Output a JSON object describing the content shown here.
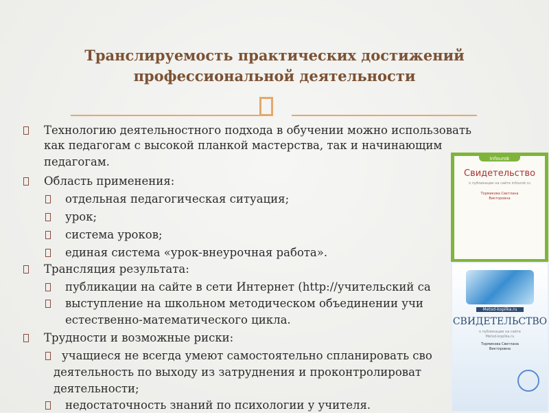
{
  "title": [
    "Транслируемость практических достижений",
    "профессиональной деятельности"
  ],
  "items": [
    {
      "level": 1,
      "lines": [
        "Технологию деятельностного подхода в обучении можно использовать",
        "как педагогам с высокой планкой мастерства, так и начинающим",
        "педагогам."
      ]
    },
    {
      "level": 1,
      "lines": [
        "Область применения:"
      ]
    },
    {
      "level": 2,
      "lines": [
        "отдельная педагогическая ситуация;"
      ]
    },
    {
      "level": 2,
      "lines": [
        "урок;"
      ]
    },
    {
      "level": 2,
      "lines": [
        "система уроков;"
      ]
    },
    {
      "level": 2,
      "lines": [
        "единая система «урок-внеурочная работа»."
      ]
    },
    {
      "level": 1,
      "lines": [
        "Трансляция результата:"
      ]
    },
    {
      "level": 2,
      "lines": [
        "публикации на сайте в сети Интернет (http://учительский са"
      ]
    },
    {
      "level": 2,
      "lines": [
        "выступление на школьном методическом объединении учи",
        "естественно-математического цикла."
      ]
    },
    {
      "level": 1,
      "lines": [
        "Трудности и возможные риски:"
      ]
    },
    {
      "level": 2,
      "lines": [
        "учащиеся не всегда умеют самостоятельно спланировать сво",
        "деятельность по выходу из затруднения и проконтролироват",
        "деятельности;"
      ]
    },
    {
      "level": 2,
      "lines": [
        "недостаточность знаний по психологии у учителя."
      ]
    }
  ],
  "cert1": {
    "logo": "infourok",
    "title": "Свидетельство",
    "sub": "о публикации на сайте infourok.ru",
    "name": "Тормикова Светлана Викторовна"
  },
  "cert2": {
    "logo": "Metod-kopilka.ru",
    "title": "СВИДЕТЕЛЬСТВО",
    "sub": "о публикации на сайте Metod-kopilka.ru",
    "name": "Тормикова Светлана Викторовна"
  }
}
